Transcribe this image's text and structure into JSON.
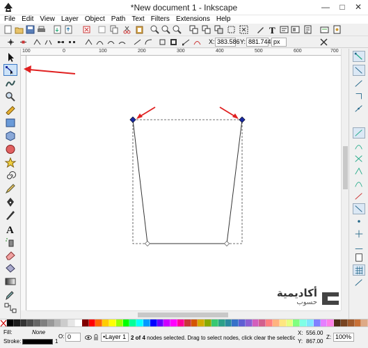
{
  "window": {
    "title": "*New document 1 - Inkscape",
    "minimize_glyph": "—",
    "maximize_glyph": "□",
    "close_glyph": "✕"
  },
  "menu": [
    "File",
    "Edit",
    "View",
    "Layer",
    "Object",
    "Path",
    "Text",
    "Filters",
    "Extensions",
    "Help"
  ],
  "controls": {
    "x_label": "X:",
    "x_value": "383.586",
    "y_label": "Y:",
    "y_value": "881.744",
    "unit": "px"
  },
  "ruler": {
    "ticks": [
      "100",
      "0",
      "100",
      "200",
      "300",
      "400",
      "500",
      "600",
      "700"
    ]
  },
  "toolbox": {
    "active_tool": "node-tool"
  },
  "status": {
    "fill_label": "Fill:",
    "fill_value": "None",
    "stroke_label": "Stroke:",
    "stroke_width": "1",
    "opacity_label": "O:",
    "opacity_value": "0",
    "layer": "•Layer 1",
    "message_bold": "2 of 4",
    "message_rest": " nodes selected. Drag to select nodes, click clear the selection",
    "x_label": "X:",
    "x_value": "556.00",
    "y_label": "Y:",
    "y_value": "867.00",
    "zoom_label": "Z:",
    "zoom_value": "100%"
  },
  "watermark": {
    "line1": "أكاديمية",
    "line2": "حسوب"
  },
  "colors": {
    "accent_selected": "#3b78c4",
    "annotation_arrow": "#e02020",
    "node_selected": "#1a2aa0"
  },
  "palette": [
    "#000000",
    "#1a1a1a",
    "#333333",
    "#4d4d4d",
    "#666666",
    "#808080",
    "#999999",
    "#b3b3b3",
    "#cccccc",
    "#e6e6e6",
    "#ffffff",
    "#800000",
    "#ff0000",
    "#ff6600",
    "#ffcc00",
    "#ffff00",
    "#99ff00",
    "#00ff00",
    "#00ff99",
    "#00ffff",
    "#0099ff",
    "#0000ff",
    "#6600ff",
    "#cc00ff",
    "#ff00ff",
    "#ff0099",
    "#c83737",
    "#d45500",
    "#d4aa00",
    "#88aa00",
    "#37c871",
    "#2ca089",
    "#2c89a0",
    "#3771c8",
    "#5f5fd3",
    "#8d5fd3",
    "#d35fbc",
    "#d35f8d",
    "#ff8080",
    "#ffb380",
    "#ffe680",
    "#e5ff80",
    "#80ff80",
    "#80ffe6",
    "#80e5ff",
    "#8080ff",
    "#e580ff",
    "#ff80e5",
    "#502d16",
    "#784421",
    "#a05a2c",
    "#c87137",
    "#deaa87"
  ]
}
